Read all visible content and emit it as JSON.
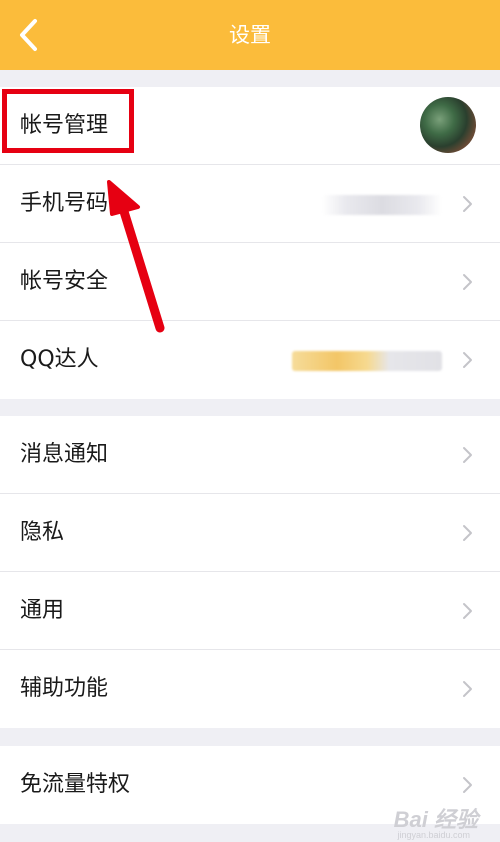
{
  "header": {
    "title": "设置",
    "back_icon": "chevron-left-icon"
  },
  "groups": [
    {
      "rows": [
        {
          "label": "帐号管理",
          "accessory": "avatar"
        },
        {
          "label": "手机号码",
          "accessory": "chevron"
        },
        {
          "label": "帐号安全",
          "accessory": "chevron"
        },
        {
          "label": "QQ达人",
          "accessory": "chevron"
        }
      ]
    },
    {
      "rows": [
        {
          "label": "消息通知",
          "accessory": "chevron"
        },
        {
          "label": "隐私",
          "accessory": "chevron"
        },
        {
          "label": "通用",
          "accessory": "chevron"
        },
        {
          "label": "辅助功能",
          "accessory": "chevron"
        }
      ]
    },
    {
      "rows": [
        {
          "label": "免流量特权",
          "accessory": "chevron"
        }
      ]
    }
  ],
  "watermark": {
    "brand": "Bai 经验",
    "url": "jingyan.baidu.com"
  },
  "colors": {
    "header_bg": "#fbbc3b",
    "annotation": "#e60012"
  }
}
